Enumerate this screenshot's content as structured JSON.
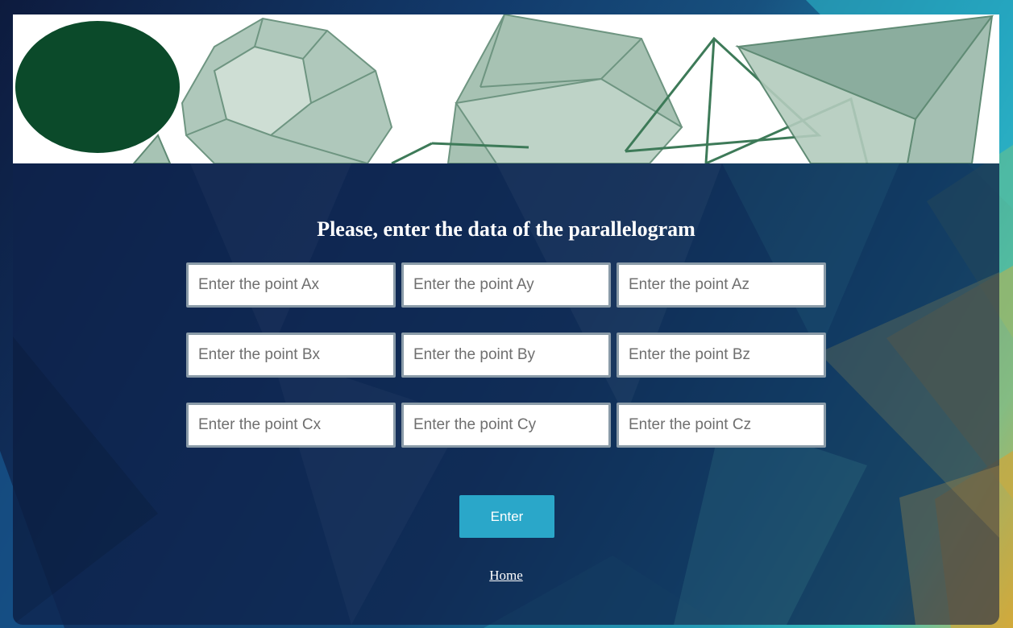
{
  "form": {
    "title": "Please, enter the data of the parallelogram",
    "fields": [
      {
        "placeholder": "Enter the point Ax",
        "value": ""
      },
      {
        "placeholder": "Enter the point Ay",
        "value": ""
      },
      {
        "placeholder": "Enter the point Az",
        "value": ""
      },
      {
        "placeholder": "Enter the point Bx",
        "value": ""
      },
      {
        "placeholder": "Enter the point By",
        "value": ""
      },
      {
        "placeholder": "Enter the point Bz",
        "value": ""
      },
      {
        "placeholder": "Enter the point Cx",
        "value": ""
      },
      {
        "placeholder": "Enter the point Cy",
        "value": ""
      },
      {
        "placeholder": "Enter the point Cz",
        "value": ""
      }
    ],
    "submit_label": "Enter",
    "home_link": "Home"
  },
  "colors": {
    "button": "#2aa7c9",
    "panel": "#0e234b",
    "banner_shapes": "#8fae9e",
    "banner_ellipse": "#0b4a2a"
  },
  "icons": [
    "geometric-shapes-banner"
  ]
}
